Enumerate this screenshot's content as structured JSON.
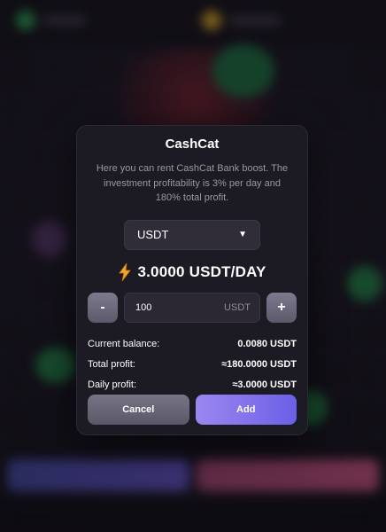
{
  "modal": {
    "title": "CashCat",
    "description": "Here you can rent CashCat Bank boost. The investment profitability is 3% per day and 180% total profit.",
    "currency": {
      "selected": "USDT",
      "caret": "▼"
    },
    "rate": {
      "icon": "lightning-bolt-icon",
      "text": "3.0000 USDT/DAY"
    },
    "amount": {
      "value": "100",
      "unit": "USDT",
      "minus_label": "-",
      "plus_label": "+"
    },
    "stats": [
      {
        "label": "Current balance:",
        "value": "0.0080 USDT"
      },
      {
        "label": "Total profit:",
        "value": "≈180.0000 USDT"
      },
      {
        "label": "Daily profit:",
        "value": "≈3.0000 USDT"
      }
    ],
    "actions": {
      "cancel_label": "Cancel",
      "add_label": "Add"
    }
  },
  "colors": {
    "accent_start": "#9c87f0",
    "accent_end": "#6c5fe6",
    "modal_bg": "#1c1a22",
    "muted_text": "#9a97a4"
  }
}
